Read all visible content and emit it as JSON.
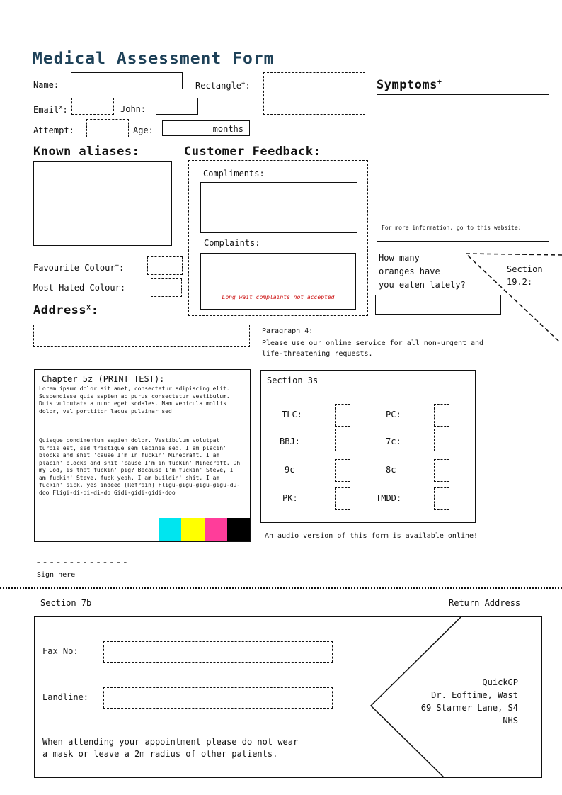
{
  "title": "Medical Assessment Form",
  "fields": {
    "name_label": "Name:",
    "rectangle_label": "Rectangle",
    "req_plus": "+",
    "email_label": "Email",
    "req_x": "x",
    "john_label": "John:",
    "attempt_label": "Attempt:",
    "age_label": "Age:",
    "age_unit": "months",
    "colon": ":"
  },
  "symptoms": {
    "label": "Symptoms",
    "info": "For more information, go to this website:"
  },
  "aliases": {
    "label": "Known aliases:"
  },
  "feedback": {
    "label": "Customer Feedback:",
    "compliments": "Compliments:",
    "complaints": "Complaints:",
    "complaints_note": "Long wait complaints not accepted"
  },
  "colours": {
    "favourite": "Favourite Colour",
    "most_hated": "Most Hated Colour:"
  },
  "address": {
    "label": "Address"
  },
  "oranges": {
    "line1": "How many",
    "line2": "oranges have",
    "line3": "you eaten lately?"
  },
  "section192": {
    "line1": "Section",
    "line2": "19.2:"
  },
  "paragraph4": {
    "title": "Paragraph 4:",
    "line1": "Please use our online service for all non-urgent and",
    "line2": "life-threatening requests."
  },
  "chapter": {
    "title": "Chapter 5z (PRINT TEST):",
    "para1": "Lorem ipsum dolor sit amet, consectetur adipiscing elit. Suspendisse quis sapien ac purus consectetur vestibulum. Duis vulputate a nunc eget sodales. Nam vehicula mollis dolor, vel porttitor lacus pulvinar sed",
    "para2": "Quisque condimentum sapien dolor. Vestibulum volutpat turpis est, sed tristique sem lacinia sed.   I am placin' blocks and shit 'cause I'm in fuckin' Minecraft. I am placin' blocks and shit 'cause I'm in fuckin' Minecraft. Oh my God, is that fuckin' pig? Because I'm fuckin' Steve, I am fuckin' Steve, fuck yeah. I am buildin' shit, I am fuckin' sick, yes indeed [Refrain] Fligu-gigu-gigu-gigu-du-doo Fligi-di-di-di-do Gidi-gidi-gidi-doo",
    "swatches": [
      "#00e5ef",
      "#ffff00",
      "#ff3d9a",
      "#000000"
    ]
  },
  "section3s": {
    "title": "Section 3s",
    "items": [
      "TLC:",
      "PC:",
      "BBJ:",
      "7c:",
      "9c",
      "8c",
      "PK:",
      "TMDD:"
    ]
  },
  "audio_note": "An audio version of this form is available online!",
  "signature": {
    "line": "--------------",
    "label": "Sign here"
  },
  "section7b": {
    "title": "Section 7b",
    "return_label": "Return Address",
    "fax_label": "Fax No:",
    "landline_label": "Landline:",
    "note_line1": "When attending your appointment please do not wear",
    "note_line2": "a mask or leave a 2m radius of other patients.",
    "address_lines": [
      "QuickGP",
      "Dr. Eoftime, Wast",
      "69 Starmer Lane, S4",
      "NHS"
    ]
  }
}
